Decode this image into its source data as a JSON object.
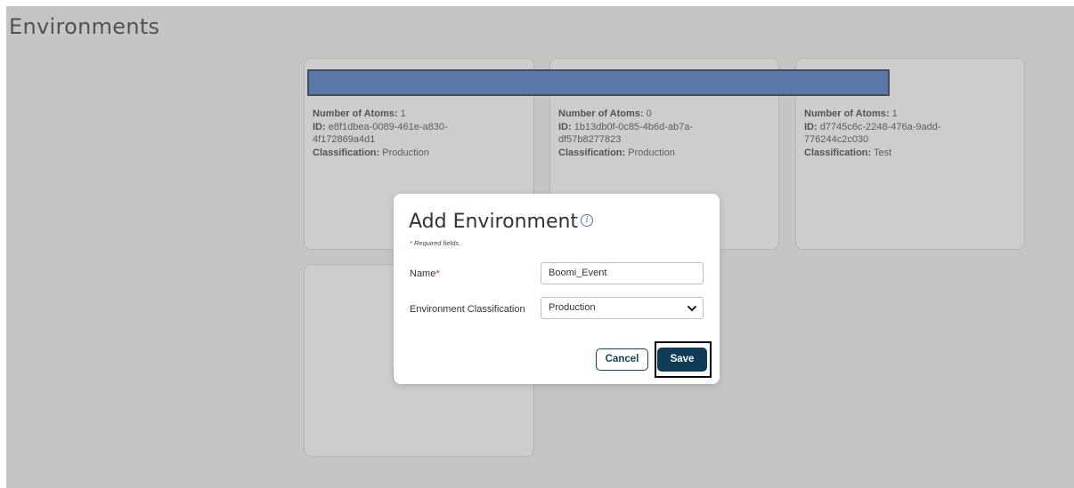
{
  "page": {
    "title": "Environments"
  },
  "cards": [
    {
      "atoms_label": "Number of Atoms:",
      "atoms_value": "1",
      "id_label": "ID:",
      "id_line1": "e8f1dbea-0089-461e-a830-",
      "id_line2": "4f172869a4d1",
      "classification_label": "Classification:",
      "classification_value": "Production"
    },
    {
      "atoms_label": "Number of Atoms:",
      "atoms_value": "0",
      "id_label": "ID:",
      "id_line1": "1b13db0f-0c85-4b6d-ab7a-",
      "id_line2": "df57b8277823",
      "classification_label": "Classification:",
      "classification_value": "Production"
    },
    {
      "atoms_label": "Number of Atoms:",
      "atoms_value": "1",
      "id_label": "ID:",
      "id_line1": "d7745c6c-2248-476a-9add-",
      "id_line2": "776244c2c030",
      "classification_label": "Classification:",
      "classification_value": "Test"
    }
  ],
  "modal": {
    "title": "Add Environment",
    "info_icon": "info-icon",
    "required_star": "*",
    "required_note": "Required fields.",
    "name_label": "Name",
    "name_required_star": "*",
    "name_value": "Boomi_Event",
    "classification_label": "Environment Classification",
    "classification_value": "Production",
    "cancel_label": "Cancel",
    "save_label": "Save"
  },
  "colors": {
    "primary": "#0f3b57",
    "redaction": "#4472c4",
    "required": "#c0392b"
  }
}
